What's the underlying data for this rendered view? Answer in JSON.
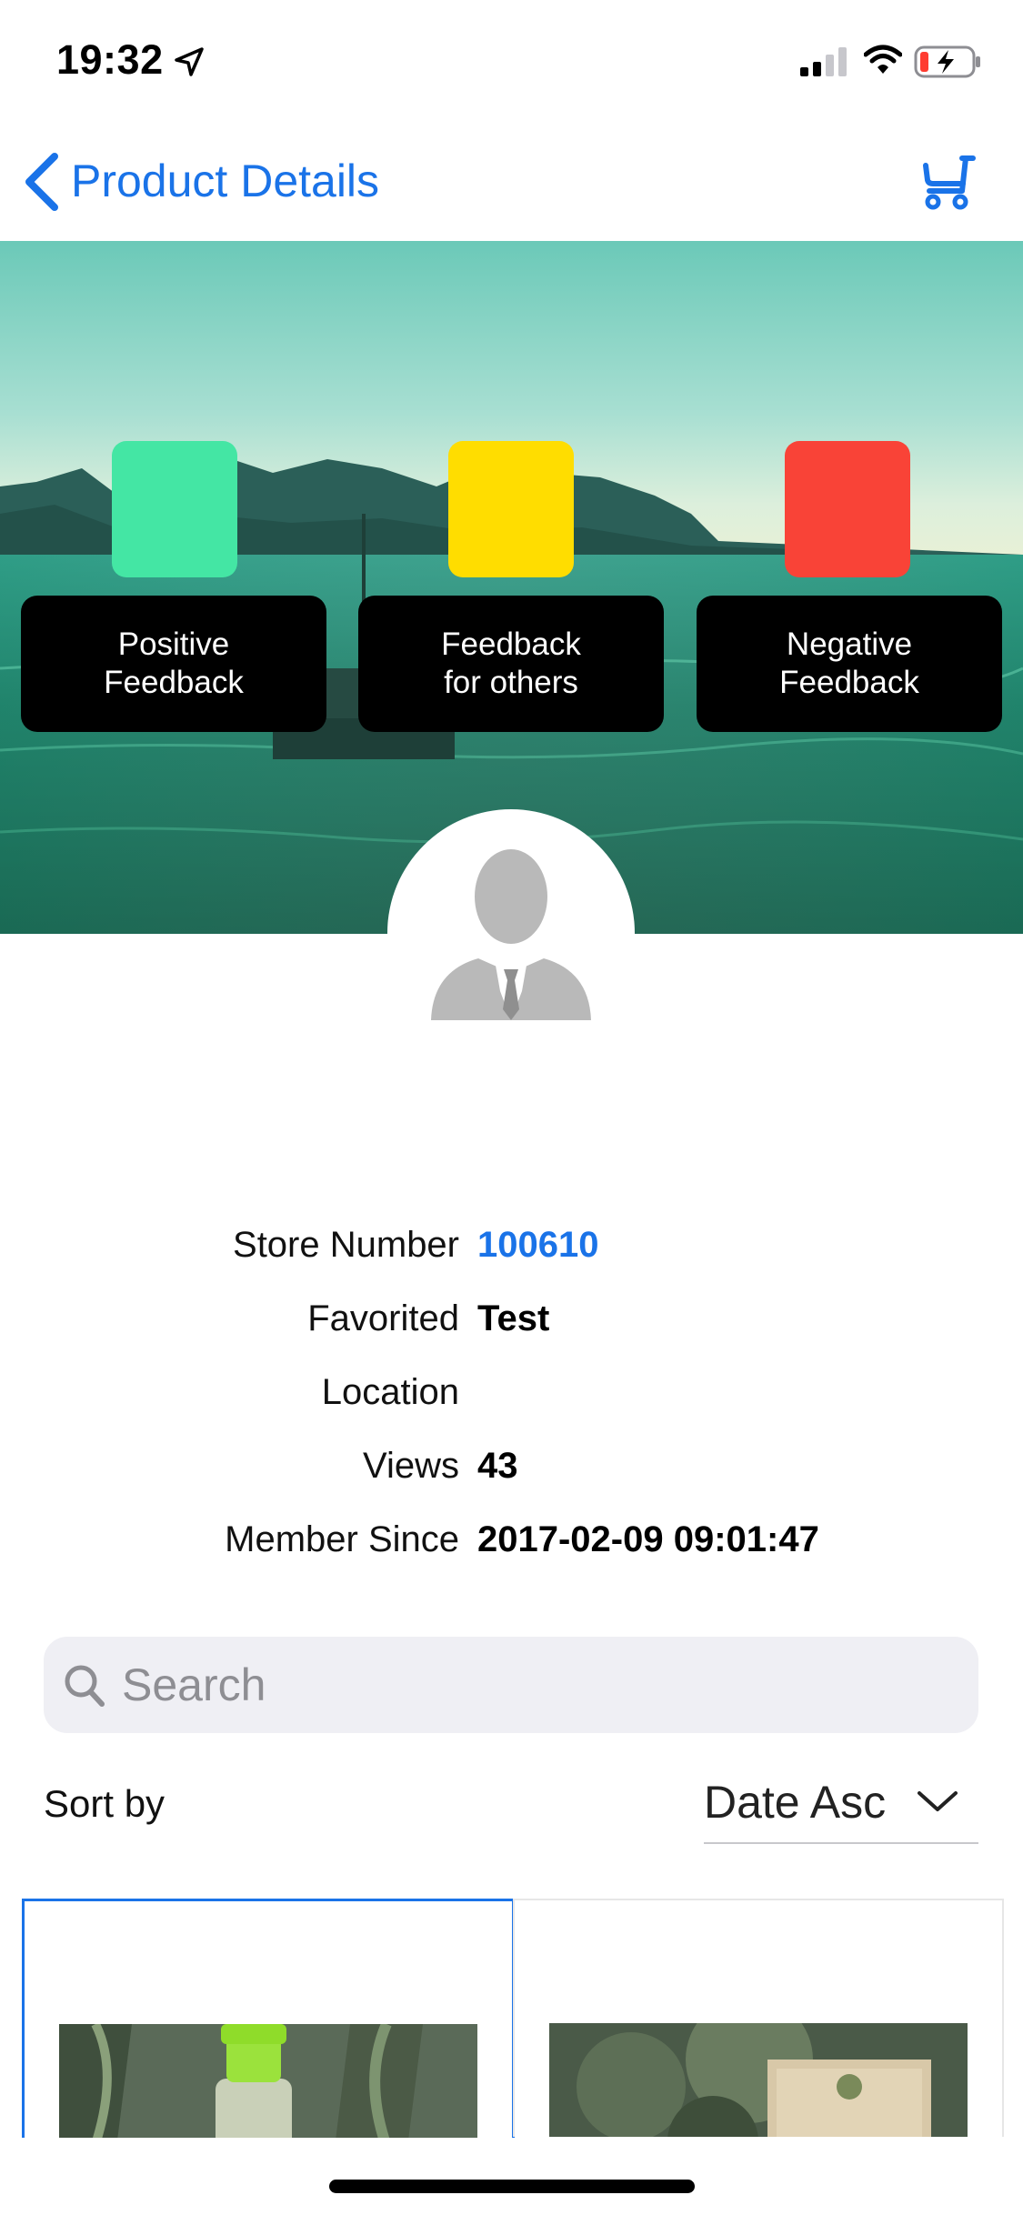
{
  "status_bar": {
    "time": "19:32",
    "icons": [
      "location-arrow-icon",
      "cellular-signal-icon",
      "wifi-icon",
      "battery-charging-icon"
    ]
  },
  "nav": {
    "title": "Product Details",
    "back_icon": "chevron-left-icon",
    "cart_icon": "cart-icon",
    "accent_color": "#1a73e8"
  },
  "feedback": [
    {
      "label": "Positive\nFeedback",
      "color": "#44e6a4"
    },
    {
      "label": "Feedback\nfor others",
      "color": "#ffdd00"
    },
    {
      "label": "Negative\nFeedback",
      "color": "#f94337"
    }
  ],
  "profile": {
    "avatar_icon": "user-placeholder-icon"
  },
  "info": {
    "store_number_label": "Store Number",
    "store_number_value": "100610",
    "favorited_label": "Favorited",
    "favorited_value": "Test",
    "location_label": "Location",
    "location_value": "",
    "views_label": "Views",
    "views_value": "43",
    "member_since_label": "Member Since",
    "member_since_value": "2017-02-09 09:01:47"
  },
  "search": {
    "placeholder": "Search",
    "icon": "search-icon"
  },
  "sort": {
    "label": "Sort by",
    "selected": "Date Asc",
    "icon": "chevron-down-icon"
  },
  "products": [
    {
      "selected": true
    },
    {
      "selected": false
    }
  ]
}
